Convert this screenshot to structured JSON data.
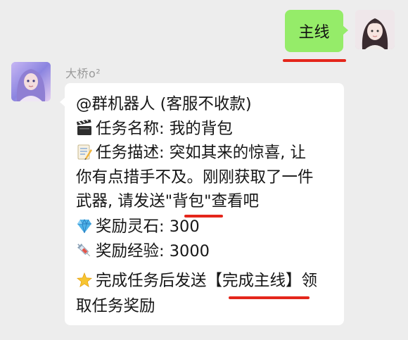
{
  "sent": {
    "text": "主线"
  },
  "received": {
    "sender": "大桥o²",
    "lines": [
      "@群机器人 (客服不收款)",
      "任务名称: 我的背包",
      "任务描述: 突如其来的惊喜, 让",
      "你有点措手不及。刚刚获取了一件",
      "武器, 请发送\"背包\"查看吧",
      "奖励灵石: 300",
      "奖励经验: 3000",
      "完成任务后发送【完成主线】领",
      "取任务奖励"
    ],
    "icons": [
      "clapperboard-icon",
      "memo-icon",
      "gem-icon",
      "syringe-icon",
      "glowing-star-icon"
    ]
  },
  "colors": {
    "background": "#ededed",
    "sent_bubble": "#95ec69",
    "received_bubble": "#ffffff",
    "annotation_red": "#e4261b"
  }
}
